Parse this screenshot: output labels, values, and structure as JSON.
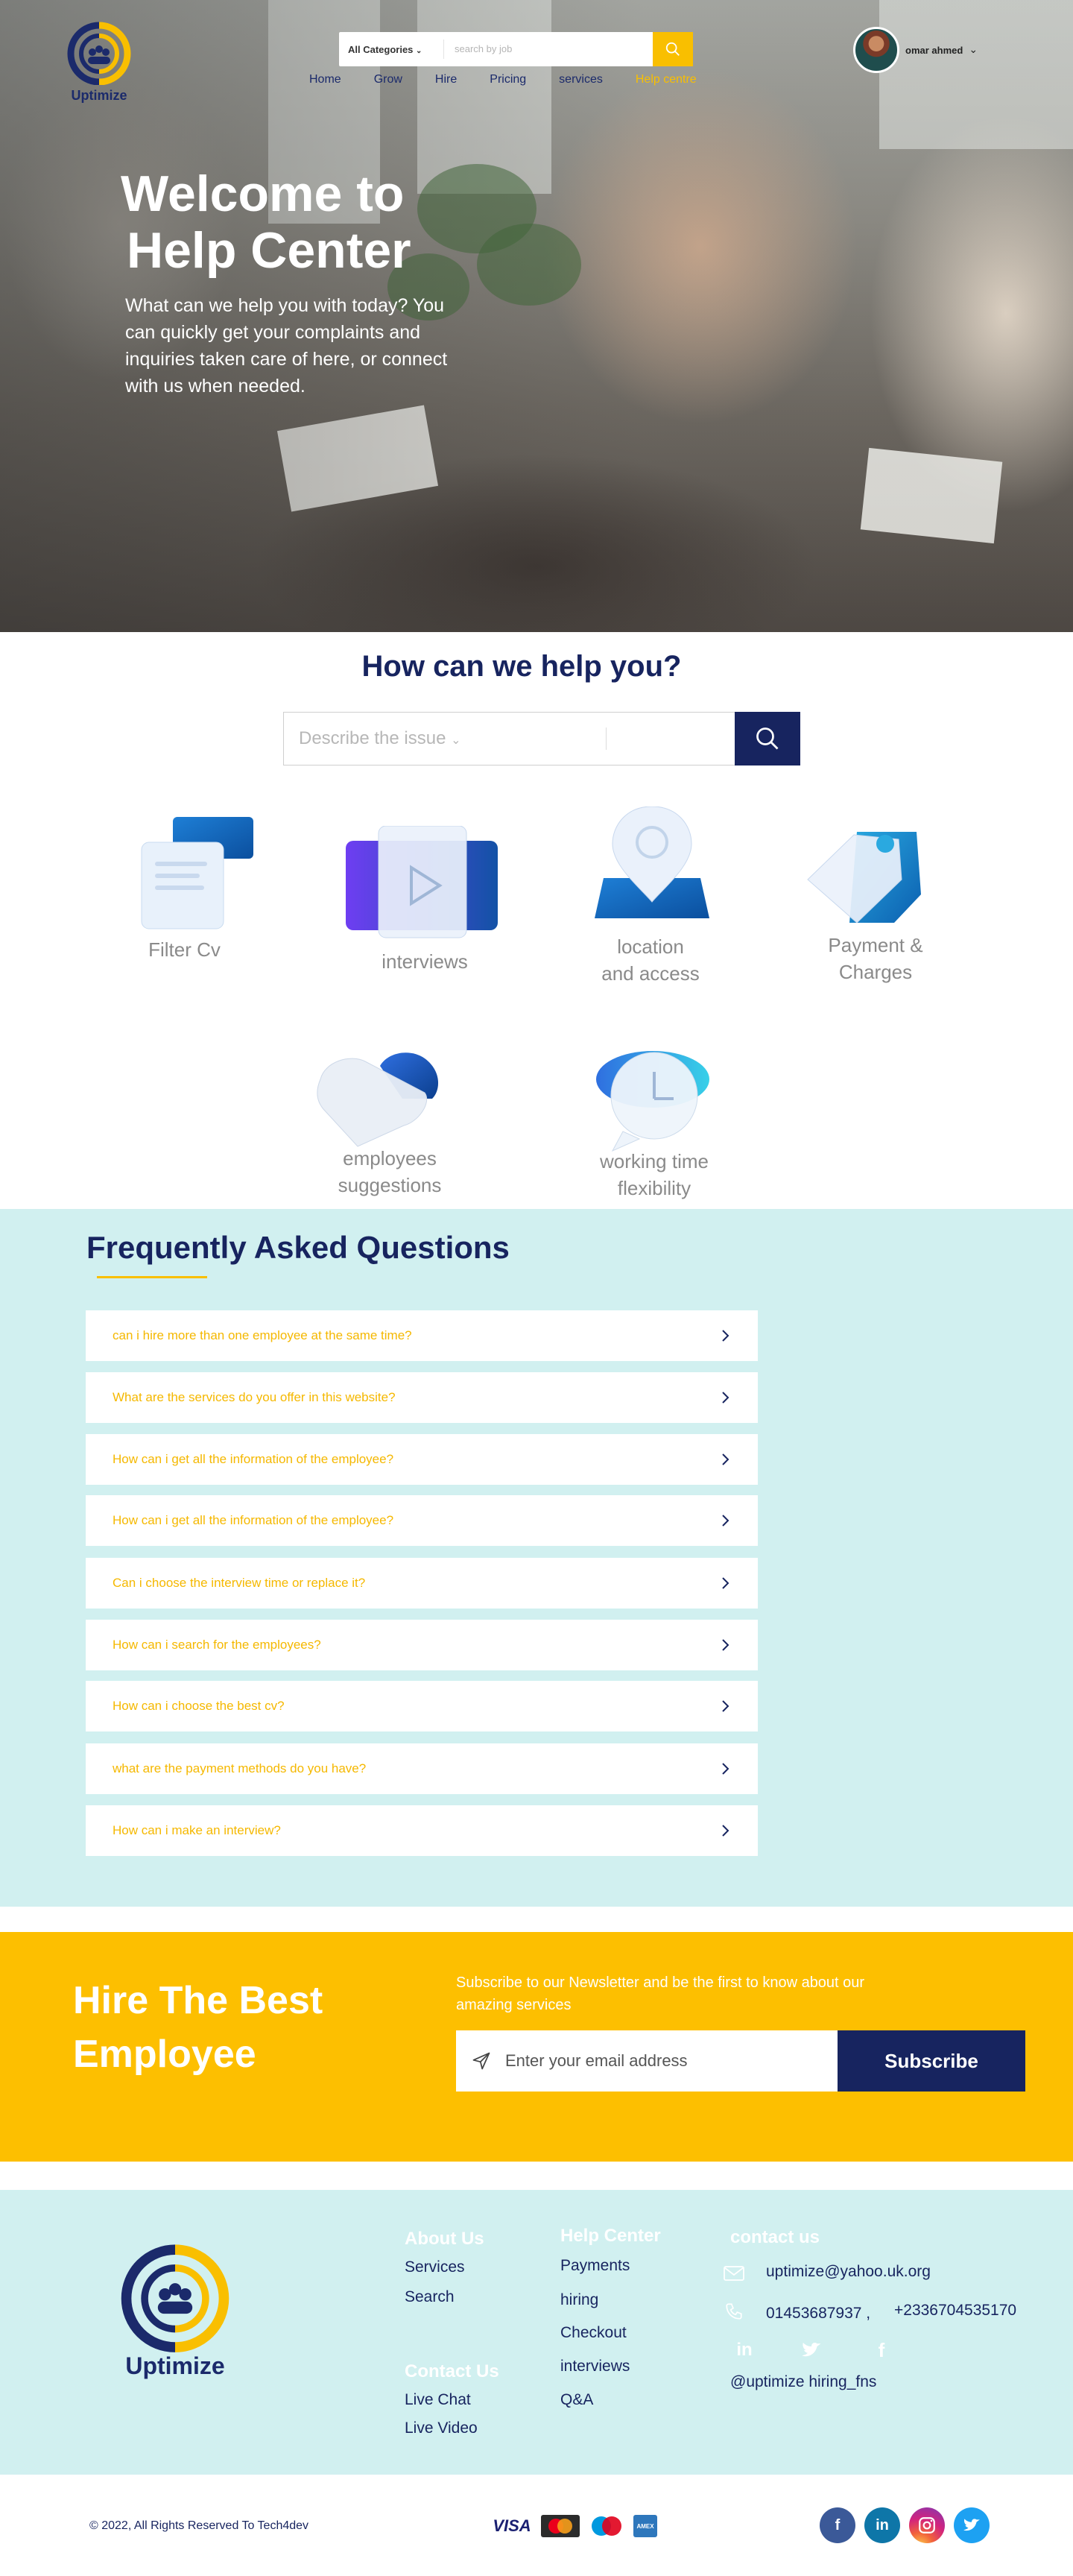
{
  "brand": {
    "name": "Uptimize",
    "accent": "#f9bf00",
    "navy": "#17245f",
    "mint": "#d1f0f0"
  },
  "header": {
    "search": {
      "category": "All Categories",
      "placeholder": "search by job"
    },
    "nav": [
      "Home",
      "Grow",
      "Hire",
      "Pricing",
      "services",
      "Help centre"
    ],
    "active_nav": "Help centre",
    "user": {
      "name": "omar ahmed"
    }
  },
  "hero": {
    "title_line1": "Welcome to",
    "title_line2": "Help Center",
    "subtitle": "What can we help you with today? You can quickly get your complaints and inquiries taken care of here, or connect with us when needed."
  },
  "help": {
    "title": "How can we help you?",
    "issue_label": "Describe the issue",
    "categories": [
      {
        "line1": "Filter Cv",
        "line2": "",
        "icon": "filter-cv-icon"
      },
      {
        "line1": "interviews",
        "line2": "",
        "icon": "video-play-icon"
      },
      {
        "line1": "location",
        "line2": "and access",
        "icon": "location-pin-icon"
      },
      {
        "line1": "Payment &",
        "line2": "Charges",
        "icon": "price-tag-icon"
      },
      {
        "line1": "employees",
        "line2": "suggestions",
        "icon": "heart-icon"
      },
      {
        "line1": "working time",
        "line2": "flexibility",
        "icon": "clock-chat-icon"
      }
    ]
  },
  "faq": {
    "title": "Frequently Asked Questions",
    "items": [
      "can i hire more than one employee at the same time?",
      "What are the services do you offer in this website?",
      "How can i get all the information of the employee?",
      "How can i get all the information of the employee?",
      "Can i choose the interview time or replace it?",
      "How can i search for the employees?",
      "How can i choose the best cv?",
      "what are the payment methods do you have?",
      "How can i make an interview?"
    ]
  },
  "newsletter": {
    "title_line1": "Hire The Best",
    "title_line2": "Employee",
    "subtitle": "Subscribe to our Newsletter and be the first to know about  our amazing services",
    "placeholder": "Enter your email address",
    "button": "Subscribe"
  },
  "footer": {
    "about": {
      "heading": "About Us",
      "links": [
        "Services",
        "Search"
      ]
    },
    "contact_us": {
      "heading": "Contact Us",
      "links": [
        "Live Chat",
        "Live Video"
      ]
    },
    "help": {
      "heading": "Help Center",
      "links": [
        "Payments",
        "hiring",
        "Checkout",
        "interviews",
        "Q&A"
      ]
    },
    "contact": {
      "heading": "contact us",
      "email": "uptimize@yahoo.uk.org",
      "phone1": "01453687937 ,",
      "phone2": "+2336704535170",
      "handle": "@uptimize hiring_fns"
    },
    "copyright": "© 2022, All Rights Reserved To Tech4dev",
    "payments": [
      "VISA",
      "MasterCard",
      "Maestro",
      "American Express"
    ]
  }
}
